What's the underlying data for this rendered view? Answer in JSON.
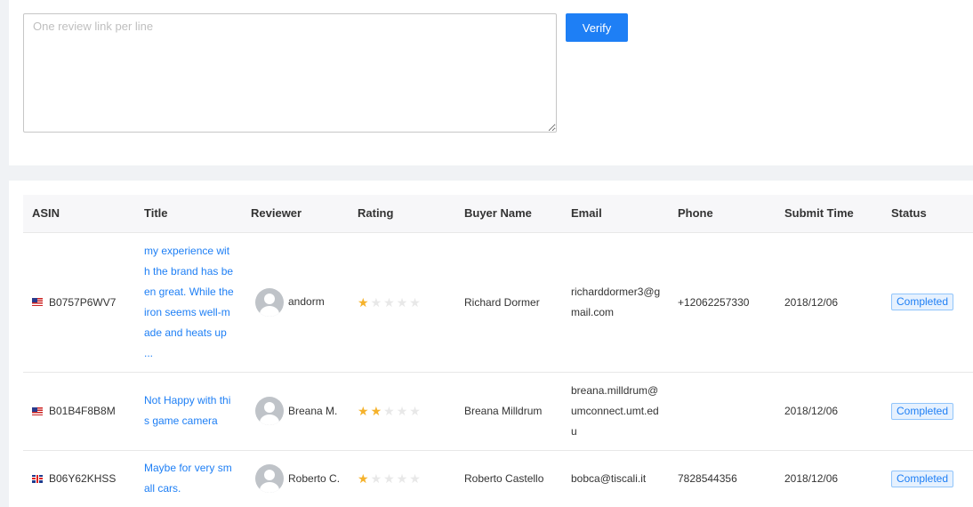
{
  "verify_form": {
    "placeholder": "One review link per line",
    "value": "",
    "verify_label": "Verify"
  },
  "table": {
    "columns": [
      "ASIN",
      "Title",
      "Reviewer",
      "Rating",
      "Buyer Name",
      "Email",
      "Phone",
      "Submit Time",
      "Status"
    ],
    "rows": [
      {
        "country": "us",
        "asin": "B0757P6WV7",
        "title": "my experience with the brand has been great. While the iron seems well-made and heats up ...",
        "reviewer": "andorm",
        "rating": 1,
        "buyer_name": "Richard Dormer",
        "email": "richarddormer3@gmail.com",
        "phone": "+12062257330",
        "submit_time": "2018/12/06",
        "status": "Completed"
      },
      {
        "country": "us",
        "asin": "B01B4F8B8M",
        "title": "Not Happy with this game camera",
        "reviewer": "Breana M.",
        "rating": 2,
        "buyer_name": "Breana Milldrum",
        "email": "breana.milldrum@umconnect.umt.edu",
        "phone": "",
        "submit_time": "2018/12/06",
        "status": "Completed"
      },
      {
        "country": "uk",
        "asin": "B06Y62KHSS",
        "title": "Maybe for very small cars.",
        "reviewer": "Roberto C.",
        "rating": 1,
        "buyer_name": "Roberto Castello",
        "email": "bobca@tiscali.it",
        "phone": "7828544356",
        "submit_time": "2018/12/06",
        "status": "Completed"
      }
    ]
  },
  "colors": {
    "accent": "#1e7ff5",
    "star_on": "#f5b22b",
    "star_off": "#e8e8e8"
  },
  "icons": {
    "star": "star-icon",
    "avatar": "avatar-icon",
    "flag_us": "us-flag-icon",
    "flag_uk": "uk-flag-icon"
  }
}
